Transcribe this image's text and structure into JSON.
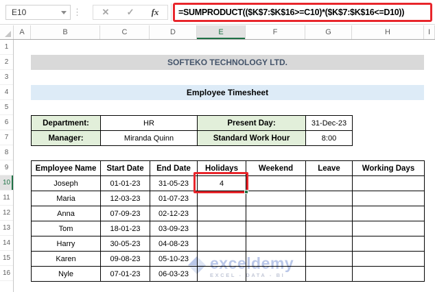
{
  "formula_bar": {
    "name_box": "E10",
    "cancel_icon": "✕",
    "enter_icon": "✓",
    "fx_icon": "fx",
    "formula": "=SUMPRODUCT(($K$7:$K$16>=C10)*($K$7:$K$16<=D10))"
  },
  "grid": {
    "column_headers": [
      "A",
      "B",
      "C",
      "D",
      "E",
      "F",
      "G",
      "H",
      "I"
    ],
    "selected_column": "E",
    "row_headers": [
      "1",
      "2",
      "3",
      "4",
      "5",
      "6",
      "7",
      "8",
      "9",
      "10",
      "11",
      "12",
      "13",
      "14",
      "15",
      "16"
    ],
    "selected_row": "10"
  },
  "sheet": {
    "company_title": "SOFTEKO TECHNOLOGY LTD.",
    "sheet_title": "Employee Timesheet",
    "info": {
      "department_label": "Department:",
      "department_value": "HR",
      "present_day_label": "Present Day:",
      "present_day_value": "31-Dec-23",
      "manager_label": "Manager:",
      "manager_value": "Miranda Quinn",
      "work_hour_label": "Standard Work Hour",
      "work_hour_value": "8:00"
    },
    "table": {
      "headers": [
        "Employee Name",
        "Start Date",
        "End Date",
        "Holidays",
        "Weekend",
        "Leave",
        "Working Days"
      ],
      "rows": [
        [
          "Joseph",
          "01-01-23",
          "31-05-23",
          "4",
          "",
          "",
          ""
        ],
        [
          "Maria",
          "12-03-23",
          "01-07-23",
          "",
          "",
          "",
          ""
        ],
        [
          "Anna",
          "07-09-23",
          "02-12-23",
          "",
          "",
          "",
          ""
        ],
        [
          "Tom",
          "18-01-23",
          "03-09-23",
          "",
          "",
          "",
          ""
        ],
        [
          "Harry",
          "30-05-23",
          "04-08-23",
          "",
          "",
          "",
          ""
        ],
        [
          "Karen",
          "09-08-23",
          "05-10-23",
          "",
          "",
          "",
          ""
        ],
        [
          "Nyle",
          "07-01-23",
          "06-03-23",
          "",
          "",
          "",
          ""
        ]
      ],
      "highlighted_cell": {
        "ref": "E10",
        "value": "4"
      }
    },
    "watermark": {
      "brand": "exceldemy",
      "tagline": "EXCEL - DATA - BI"
    }
  },
  "colors": {
    "highlight_red": "#e8252b",
    "excel_green": "#1e7145",
    "band_gray": "#d9d9d9",
    "band_blue": "#ddebf7",
    "cell_green": "#e2efda",
    "company_text": "#44546a",
    "watermark_blue": "#8da3d9"
  }
}
